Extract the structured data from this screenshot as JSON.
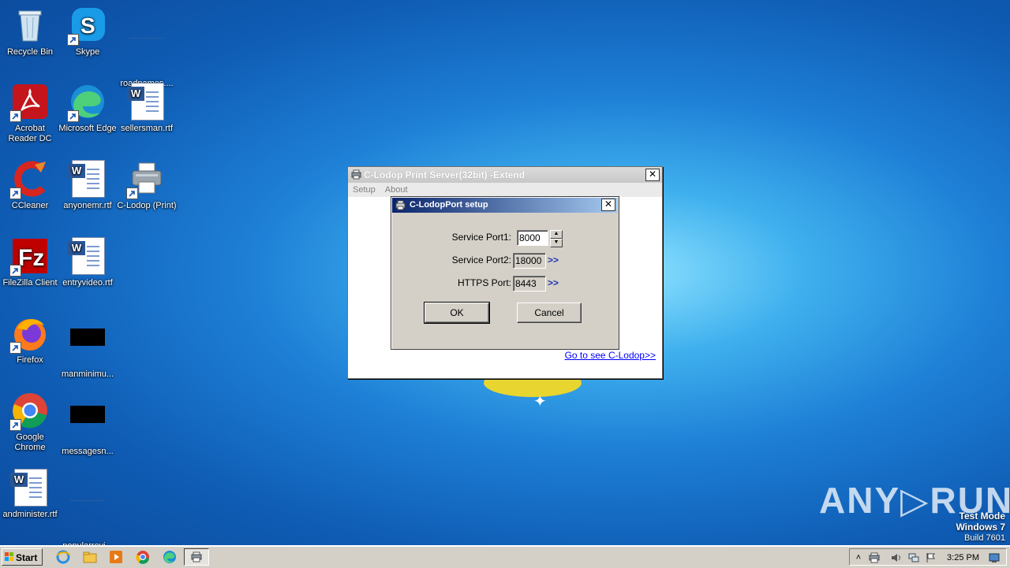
{
  "desktop": {
    "icons": [
      {
        "label": "Recycle Bin"
      },
      {
        "label": "Skype"
      },
      {
        "label": "roadnames...."
      },
      {
        "label": "Acrobat Reader DC"
      },
      {
        "label": "Microsoft Edge"
      },
      {
        "label": "sellersman.rtf"
      },
      {
        "label": "CCleaner"
      },
      {
        "label": "anyonemr.rtf"
      },
      {
        "label": "C-Lodop (Print)"
      },
      {
        "label": "FileZilla Client"
      },
      {
        "label": "entryvideo.rtf"
      },
      {
        "label": "Firefox"
      },
      {
        "label": "manminimu..."
      },
      {
        "label": "Google Chrome"
      },
      {
        "label": "messagesn..."
      },
      {
        "label": "andminister.rtf"
      },
      {
        "label": "popularrevi..."
      }
    ]
  },
  "main_window": {
    "title": "C-Lodop Print Server(32bit) -Extend",
    "close": "✕",
    "menu": [
      "Setup",
      "About"
    ],
    "link": "Go to see C-Lodop>>"
  },
  "dialog": {
    "title": "C-LodopPort setup",
    "close": "✕",
    "service_port1_label": "Service Port1:",
    "service_port1_value": "8000",
    "service_port2_label": "Service Port2:",
    "service_port2_value": "18000",
    "https_port_label": "HTTPS Port:",
    "https_port_value": "8443",
    "more": ">>",
    "ok": "OK",
    "cancel": "Cancel"
  },
  "watermark": "ANY▷RUN",
  "os_info": {
    "line1": "Test Mode",
    "line2": "Windows 7",
    "line3": "Build 7601"
  },
  "taskbar": {
    "start": "Start",
    "clock": "3:25 PM"
  }
}
